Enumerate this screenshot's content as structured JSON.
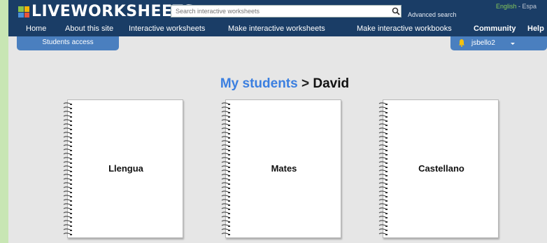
{
  "header": {
    "logo_text": "LIVEWORKSHEETS",
    "search_placeholder": "Search interactive worksheets",
    "advanced_search": "Advanced search",
    "lang_english": "English",
    "lang_separator": " - ",
    "lang_espanol": "Espa"
  },
  "nav": {
    "items": [
      {
        "label": "Home"
      },
      {
        "label": "About this site"
      },
      {
        "label": "Interactive worksheets"
      },
      {
        "label": "Make interactive worksheets"
      },
      {
        "label": "Make interactive workbooks"
      },
      {
        "label": "Community"
      },
      {
        "label": "Help"
      }
    ]
  },
  "tabs": {
    "students_access": "Students access",
    "username": "jsbello2"
  },
  "page": {
    "breadcrumb": "My students",
    "separator": " > ",
    "student_name": "David"
  },
  "notebooks": [
    {
      "title": "Llengua"
    },
    {
      "title": "Mates"
    },
    {
      "title": "Castellano"
    }
  ],
  "colors": {
    "header_bg": "#1a3d66",
    "tab_blue": "#4a7fbf",
    "link_blue": "#3b7fe0",
    "outer_bg": "#c8e6b4",
    "content_bg": "#e6e6e6"
  },
  "icons": [
    "search-icon",
    "bell-icon",
    "caret-down-icon",
    "logo-grid-icon",
    "spiral-binding-icon"
  ]
}
